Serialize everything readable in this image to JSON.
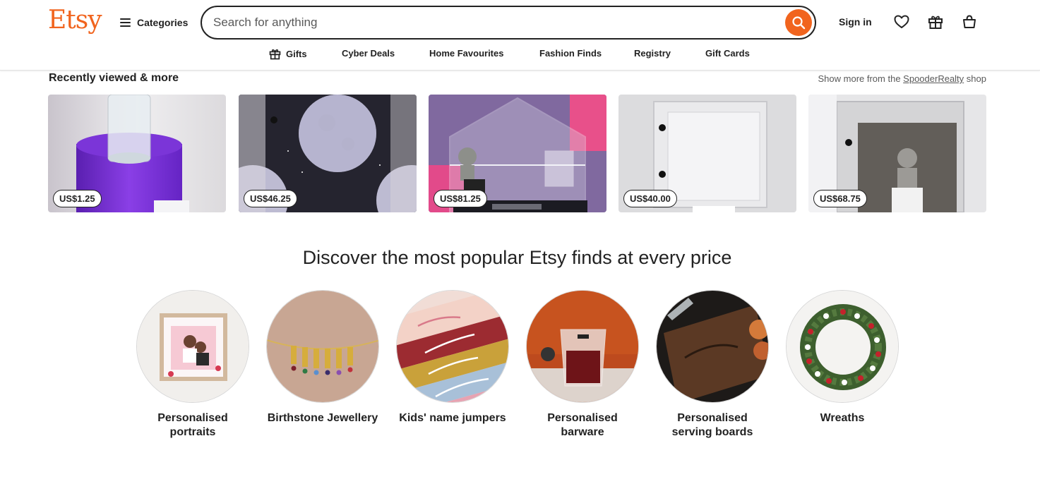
{
  "header": {
    "logo": "Etsy",
    "categories_label": "Categories",
    "search_placeholder": "Search for anything",
    "sign_in": "Sign in",
    "icons": [
      "heart-icon",
      "gift-icon",
      "cart-icon"
    ]
  },
  "nav": {
    "items": [
      {
        "label": "Gifts",
        "icon": "gift-icon"
      },
      {
        "label": "Cyber Deals"
      },
      {
        "label": "Home Favourites"
      },
      {
        "label": "Fashion Finds"
      },
      {
        "label": "Registry"
      },
      {
        "label": "Gift Cards"
      }
    ]
  },
  "recently_viewed": {
    "title": "Recently viewed & more",
    "more_prefix": "Show more from the",
    "shop_name": "SpooderRealty",
    "more_suffix": "shop",
    "items": [
      {
        "price": "US$1.25"
      },
      {
        "price": "US$46.25"
      },
      {
        "price": "US$81.25"
      },
      {
        "price": "US$40.00"
      },
      {
        "price": "US$68.75"
      }
    ]
  },
  "discover": {
    "title": "Discover the most popular Etsy finds at every price",
    "categories": [
      {
        "label": "Personalised portraits"
      },
      {
        "label": "Birthstone Jewellery"
      },
      {
        "label": "Kids' name jumpers"
      },
      {
        "label": "Personalised barware"
      },
      {
        "label": "Personalised serving boards"
      },
      {
        "label": "Wreaths"
      }
    ]
  },
  "colors": {
    "brand": "#F1641E",
    "text": "#222222"
  }
}
